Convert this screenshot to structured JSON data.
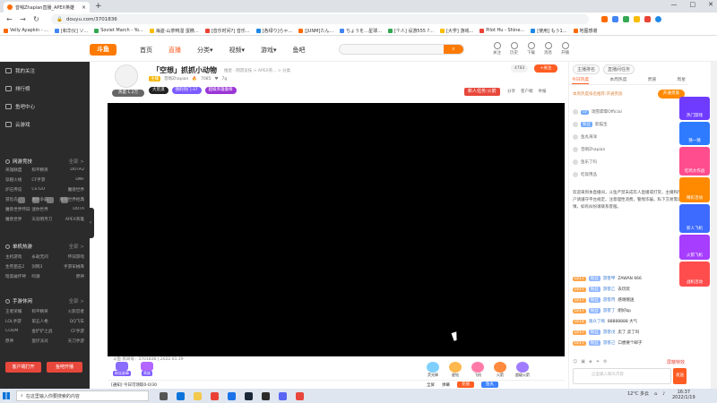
{
  "browser": {
    "tab_title": "音哨Zhapian直播_APEX英雄",
    "url": "douyu.com/3701836",
    "bookmarks": [
      "Velly Ayapkin - ...",
      "[和华仪] ソ...",
      "Soviet March - Yo...",
      "海盗·山茶鸭湿 蛋糕...",
      "[音乐时间?] 音乐...",
      "[各绿り]らゃ...",
      "[JUNM]たん...",
      "ちょうを…星球...",
      "[个人] 设游555 ?...",
      "[大学] 游戏...",
      "Pilot Hu - Shine...",
      "[使用] もう1...",
      "地图感谢"
    ],
    "icon_colors": [
      "#ff6a00",
      "#4285f4",
      "#34a853",
      "#fbbc05",
      "#ea4335",
      "#1e88e5"
    ]
  },
  "site": {
    "logo_text": "斗鱼",
    "nav": [
      "首页",
      "直播",
      "分类▾",
      "视频▾",
      "游戏▾",
      "鱼吧"
    ],
    "active_nav": "直播",
    "search_placeholder": "",
    "header_icons": [
      "关注",
      "历史",
      "下载",
      "消息",
      "开播"
    ]
  },
  "sidebar": {
    "items": [
      "我的关注",
      "排行榜",
      "鱼吧中心",
      "云游戏"
    ],
    "section_hot": "网游竞技",
    "hot_more": "全部 >",
    "hot_games": [
      "英雄联盟",
      "和平精英",
      "DOTA2",
      "穿越火线",
      "CF手游",
      "DNF",
      "炉石传说",
      "CS:GO",
      "魔兽世界",
      "冒险岛",
      "魔兽争霸",
      "魔兽世界经典",
      "魔兽世界怀旧",
      "迷你世界",
      "DOTA",
      "魔兽世界",
      "天涯明月刀",
      "APEX英雄"
    ],
    "section_single": "单机热游",
    "single_more": "全部 >",
    "single_games": [
      "主机游戏",
      "永劫无间",
      "怀旧游戏",
      "生死狙击2",
      "剑网3",
      "手游军械库",
      "暗黑破坏神",
      "鸣潮",
      "原神"
    ],
    "section_mobile": "手游休闲",
    "mobile_more": "全部 >",
    "mobile_games": [
      "王者荣耀",
      "和平精英",
      "火影忍者",
      "LOL手游",
      "第五人格",
      "QQ飞车",
      "CODM",
      "金铲铲之战",
      "CF手游",
      "原神",
      "蛋仔派对",
      "天刀手游"
    ],
    "btn_left": "客户端打开",
    "btn_right": "鱼吧开播"
  },
  "room": {
    "title": "「空想」抓抓小动物",
    "category": "推星 · 网游竞技 > APEX英... > 分类",
    "anchor_level": "主播",
    "anchor_name": "音哨Zhapian",
    "heat": "7085",
    "fans": "7g",
    "avatar_tag": "热度·1.2万",
    "tags": [
      "大荒漠",
      "我的热门·37",
      "超级英雄徽章"
    ],
    "fan_count": "4783",
    "follow_label": "+关注",
    "new_task": "新人任务:火箭",
    "actions": [
      "分享",
      "客户端",
      "举报"
    ],
    "room_info": "斗鱼 房间号：3701836 | 2022.01.19",
    "gifts_left": [
      "粉丝勋章",
      "贵族"
    ],
    "gifts_right": [
      "荧光棒",
      "星钻",
      "飞机",
      "火箭",
      "超级火箭"
    ],
    "bottom_left": "[通知] 今日可领取0-0/30",
    "bottom_right_items": [
      "全屏",
      "弹幕"
    ],
    "btn_red": "充值",
    "btn_blue": "鱼丸"
  },
  "rightpanel": {
    "top": [
      "主播排名",
      "直播间任务"
    ],
    "tabs": [
      "今日热度",
      "本周热度",
      "贵族",
      "周星"
    ],
    "noble_text": "本周热度排名推荐:开通贵族",
    "open_noble": "开通贵族",
    "list": [
      {
        "badge": "LV",
        "name": "瑞雪霏霏Official"
      },
      {
        "badge": "粉丝",
        "name": "影猫宝"
      },
      {
        "badge": "",
        "name": "鱼丸海洋"
      },
      {
        "badge": "",
        "name": "音哨Zhapian"
      },
      {
        "badge": "",
        "name": "鱼乐了吗"
      },
      {
        "badge": "",
        "name": "吃饭用品"
      }
    ],
    "notice": "欢迎来到本直播间，斗鱼严禁未成年人直播或打赏，主播和用户请遵守平台规定。注意理性消费，警惕诈骗，私下交易需谨慎，如有纠纷请联系客服。",
    "chat": [
      {
        "lv": "LV17",
        "fan": "粉丝",
        "user": "游客甲",
        "msg": "ZAWAN 666"
      },
      {
        "lv": "LV17",
        "fan": "粉丝",
        "user": "游客乙",
        "msg": "去玩玩"
      },
      {
        "lv": "LV17",
        "fan": "粉丝",
        "user": "游客丙",
        "msg": "感谢赠送"
      },
      {
        "lv": "LV17",
        "fan": "粉丝",
        "user": "游客丁",
        "msg": "刚好bp"
      },
      {
        "lv": "LV14",
        "fan": "",
        "user": "观众了啊",
        "msg": "88888888 大气"
      },
      {
        "lv": "LV17",
        "fan": "粉丝",
        "user": "游客戊",
        "msg": "卖了 卖了吗"
      },
      {
        "lv": "LV17",
        "fan": "粉丝",
        "user": "游客己",
        "msg": "口想要个邮子"
      }
    ],
    "tools_right": "屏蔽特效",
    "input_placeholder": "这里输入聊天内容",
    "send": "发送"
  },
  "rail": [
    "热门游戏",
    "猜一猜",
    "吃鸡大作战",
    "精彩活动",
    "新人飞机",
    "火箭飞机",
    "战机活动"
  ],
  "taskbar": {
    "search_placeholder": "在这里输入你要搜索的内容",
    "weather": "12°C 多云",
    "time": "16:37",
    "date": "2022/1/19"
  }
}
